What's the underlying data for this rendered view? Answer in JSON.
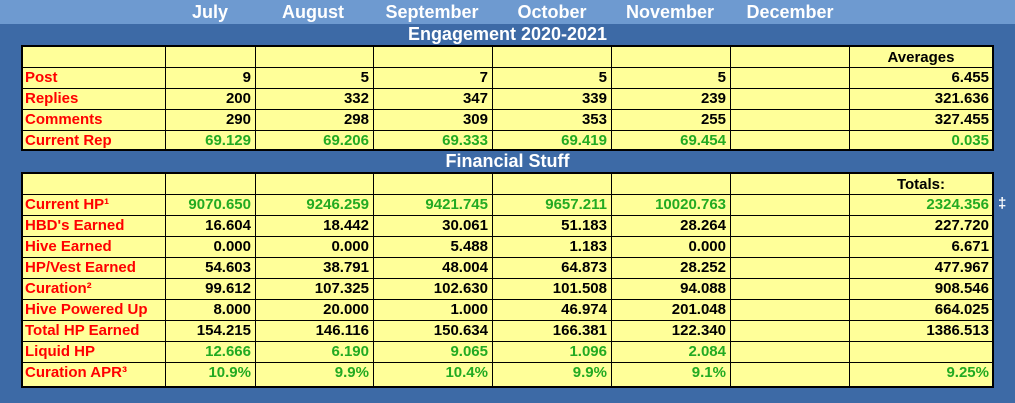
{
  "months": [
    "July",
    "August",
    "September",
    "October",
    "November",
    "December"
  ],
  "engagement": {
    "title": "Engagement 2020-2021",
    "averages_label": "Averages",
    "rows": [
      {
        "label": "Post",
        "color": "black",
        "values": [
          "9",
          "5",
          "7",
          "5",
          "5",
          ""
        ],
        "summary": "6.455"
      },
      {
        "label": "Replies",
        "color": "black",
        "values": [
          "200",
          "332",
          "347",
          "339",
          "239",
          ""
        ],
        "summary": "321.636"
      },
      {
        "label": "Comments",
        "color": "black",
        "values": [
          "290",
          "298",
          "309",
          "353",
          "255",
          ""
        ],
        "summary": "327.455"
      },
      {
        "label": "Current Rep",
        "color": "green",
        "values": [
          "69.129",
          "69.206",
          "69.333",
          "69.419",
          "69.454",
          ""
        ],
        "summary": "0.035"
      }
    ]
  },
  "financial": {
    "title": "Financial Stuff",
    "totals_label": "Totals:",
    "dagger": "‡",
    "rows": [
      {
        "label": "Current HP¹",
        "color": "green",
        "values": [
          "9070.650",
          "9246.259",
          "9421.745",
          "9657.211",
          "10020.763",
          ""
        ],
        "summary": "2324.356"
      },
      {
        "label": "HBD's Earned",
        "color": "black",
        "values": [
          "16.604",
          "18.442",
          "30.061",
          "51.183",
          "28.264",
          ""
        ],
        "summary": "227.720"
      },
      {
        "label": "Hive Earned",
        "color": "black",
        "values": [
          "0.000",
          "0.000",
          "5.488",
          "1.183",
          "0.000",
          ""
        ],
        "summary": "6.671"
      },
      {
        "label": "HP/Vest Earned",
        "color": "black",
        "values": [
          "54.603",
          "38.791",
          "48.004",
          "64.873",
          "28.252",
          ""
        ],
        "summary": "477.967"
      },
      {
        "label": "Curation²",
        "color": "black",
        "values": [
          "99.612",
          "107.325",
          "102.630",
          "101.508",
          "94.088",
          ""
        ],
        "summary": "908.546"
      },
      {
        "label": "Hive Powered Up",
        "color": "black",
        "values": [
          "8.000",
          "20.000",
          "1.000",
          "46.974",
          "201.048",
          ""
        ],
        "summary": "664.025"
      },
      {
        "label": "Total HP Earned",
        "color": "black",
        "values": [
          "154.215",
          "146.116",
          "150.634",
          "166.381",
          "122.340",
          ""
        ],
        "summary": "1386.513"
      },
      {
        "label": "Liquid HP",
        "color": "green",
        "values": [
          "12.666",
          "6.190",
          "9.065",
          "1.096",
          "2.084",
          ""
        ],
        "summary": ""
      },
      {
        "label": "Curation APR³",
        "color": "green",
        "values": [
          "10.9%",
          "9.9%",
          "10.4%",
          "9.9%",
          "9.1%",
          ""
        ],
        "summary": "9.25%"
      }
    ]
  }
}
